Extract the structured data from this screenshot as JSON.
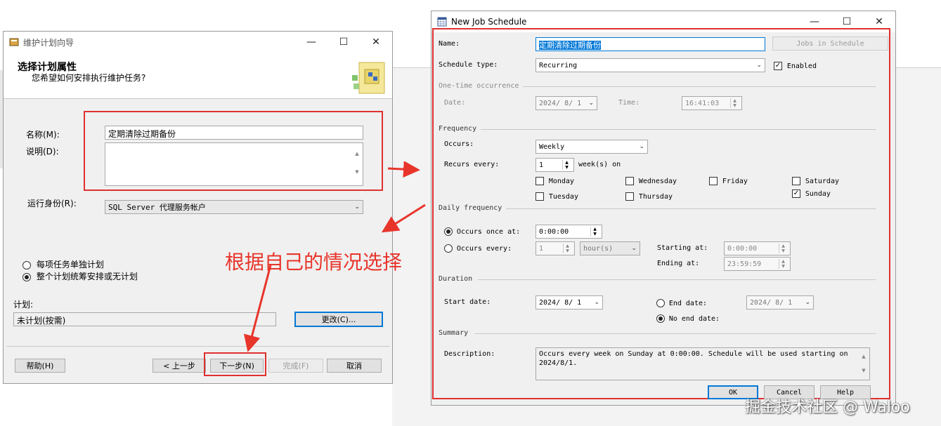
{
  "wizard": {
    "title": "维护计划向导",
    "heading": "选择计划属性",
    "subheading": "您希望如何安排执行维护任务?",
    "name_label": "名称(M):",
    "name_value": "定期清除过期备份",
    "desc_label": "说明(D):",
    "run_as_label": "运行身份(R):",
    "run_as_value": "SQL Server 代理服务帐户",
    "radio_each": "每项任务单独计划",
    "radio_whole": "整个计划统筹安排或无计划",
    "plan_label": "计划:",
    "plan_value": "未计划(按需)",
    "change_btn": "更改(C)...",
    "help_btn": "帮助(H)",
    "back_btn": "< 上一步",
    "next_btn": "下一步(N)",
    "finish_btn": "完成(F)",
    "cancel_btn": "取消"
  },
  "annotation": "根据自己的情况选择",
  "watermark": "掘金技术社区 @ Waloo",
  "schedule": {
    "title": "New Job Schedule",
    "name_label": "Name:",
    "name_value": "定期清除过期备份",
    "jobs_btn": "Jobs in Schedule",
    "type_label": "Schedule type:",
    "type_value": "Recurring",
    "enabled_label": "Enabled",
    "onetime_group": "One-time occurrence",
    "date_label": "Date:",
    "date_value": "2024/ 8/ 1",
    "time_label": "Time:",
    "time_value": "16:41:03",
    "frequency_group": "Frequency",
    "occurs_label": "Occurs:",
    "occurs_value": "Weekly",
    "recurs_label": "Recurs every:",
    "recurs_value": "1",
    "recurs_unit": "week(s) on",
    "days": {
      "monday": "Monday",
      "tuesday": "Tuesday",
      "wednesday": "Wednesday",
      "thursday": "Thursday",
      "friday": "Friday",
      "saturday": "Saturday",
      "sunday": "Sunday"
    },
    "daily_group": "Daily frequency",
    "once_label": "Occurs once at:",
    "once_value": "0:00:00",
    "every_label": "Occurs every:",
    "every_value": "1",
    "every_unit": "hour(s)",
    "starting_label": "Starting at:",
    "starting_value": "0:00:00",
    "ending_label": "Ending at:",
    "ending_value": "23:59:59",
    "duration_group": "Duration",
    "start_date_label": "Start date:",
    "start_date_value": "2024/ 8/ 1",
    "end_date_label": "End date:",
    "end_date_value": "2024/ 8/ 1",
    "no_end_label": "No end date:",
    "summary_group": "Summary",
    "desc_label": "Description:",
    "desc_value": "Occurs every week on Sunday at 0:00:00. Schedule will be used starting on 2024/8/1.",
    "ok_btn": "OK",
    "cancel_btn": "Cancel",
    "help_btn": "Help"
  },
  "colors": {
    "annotation_red": "#e03030",
    "focus_blue": "#0078d7"
  }
}
